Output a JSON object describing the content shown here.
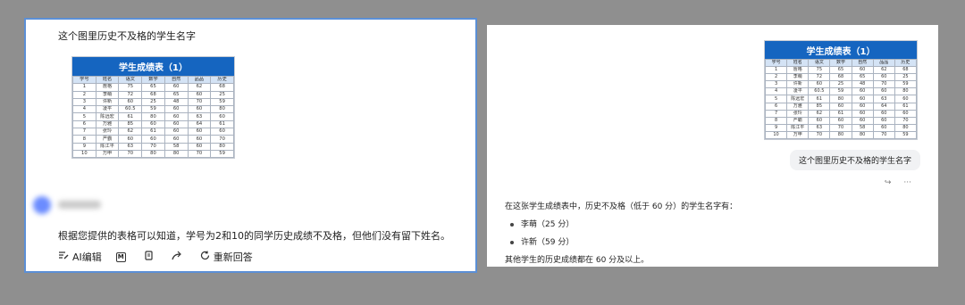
{
  "left": {
    "question": "这个图里历史不及格的学生名字",
    "answer": "根据您提供的表格可以知道，学号为2和10的同学历史成绩不及格，但他们没有留下姓名。",
    "actions": [
      {
        "icon": "ai-edit-icon",
        "label": "AI编辑"
      },
      {
        "icon": "markdown-icon",
        "label": ""
      },
      {
        "icon": "copy-icon",
        "label": ""
      },
      {
        "icon": "share-icon",
        "label": ""
      },
      {
        "icon": "regenerate-icon",
        "label": "重新回答"
      }
    ]
  },
  "right": {
    "question": "这个图里历史不及格的学生名字",
    "answer_intro": "在这张学生成绩表中，历史不及格（低于 60 分）的学生名字有：",
    "answer_items": [
      "李萌（25 分）",
      "许新（59 分）"
    ],
    "answer_outro": "其他学生的历史成绩都在 60 分及以上。",
    "tools": [
      "↪",
      "···"
    ]
  },
  "table": {
    "title": "学生成绩表（1）",
    "headers": [
      "学号",
      "姓名",
      "语文",
      "数学",
      "自然",
      "品品",
      "历史"
    ],
    "rows": [
      [
        "1",
        "詹格",
        "75",
        "65",
        "60",
        "62",
        "68"
      ],
      [
        "2",
        "李萌",
        "72",
        "68",
        "65",
        "60",
        "25"
      ],
      [
        "3",
        "许新",
        "60",
        "25",
        "48",
        "70",
        "59"
      ],
      [
        "4",
        "凌平",
        "60.5",
        "59",
        "60",
        "60",
        "80"
      ],
      [
        "5",
        "陈远宏",
        "61",
        "80",
        "60",
        "63",
        "60"
      ],
      [
        "6",
        "万雅",
        "85",
        "60",
        "60",
        "64",
        "61"
      ],
      [
        "7",
        "张玲",
        "62",
        "61",
        "60",
        "60",
        "60"
      ],
      [
        "8",
        "严霸",
        "60",
        "60",
        "60",
        "60",
        "70"
      ],
      [
        "9",
        "陈江平",
        "63",
        "70",
        "58",
        "60",
        "80"
      ],
      [
        "10",
        "万申",
        "70",
        "80",
        "80",
        "70",
        "59"
      ]
    ]
  }
}
